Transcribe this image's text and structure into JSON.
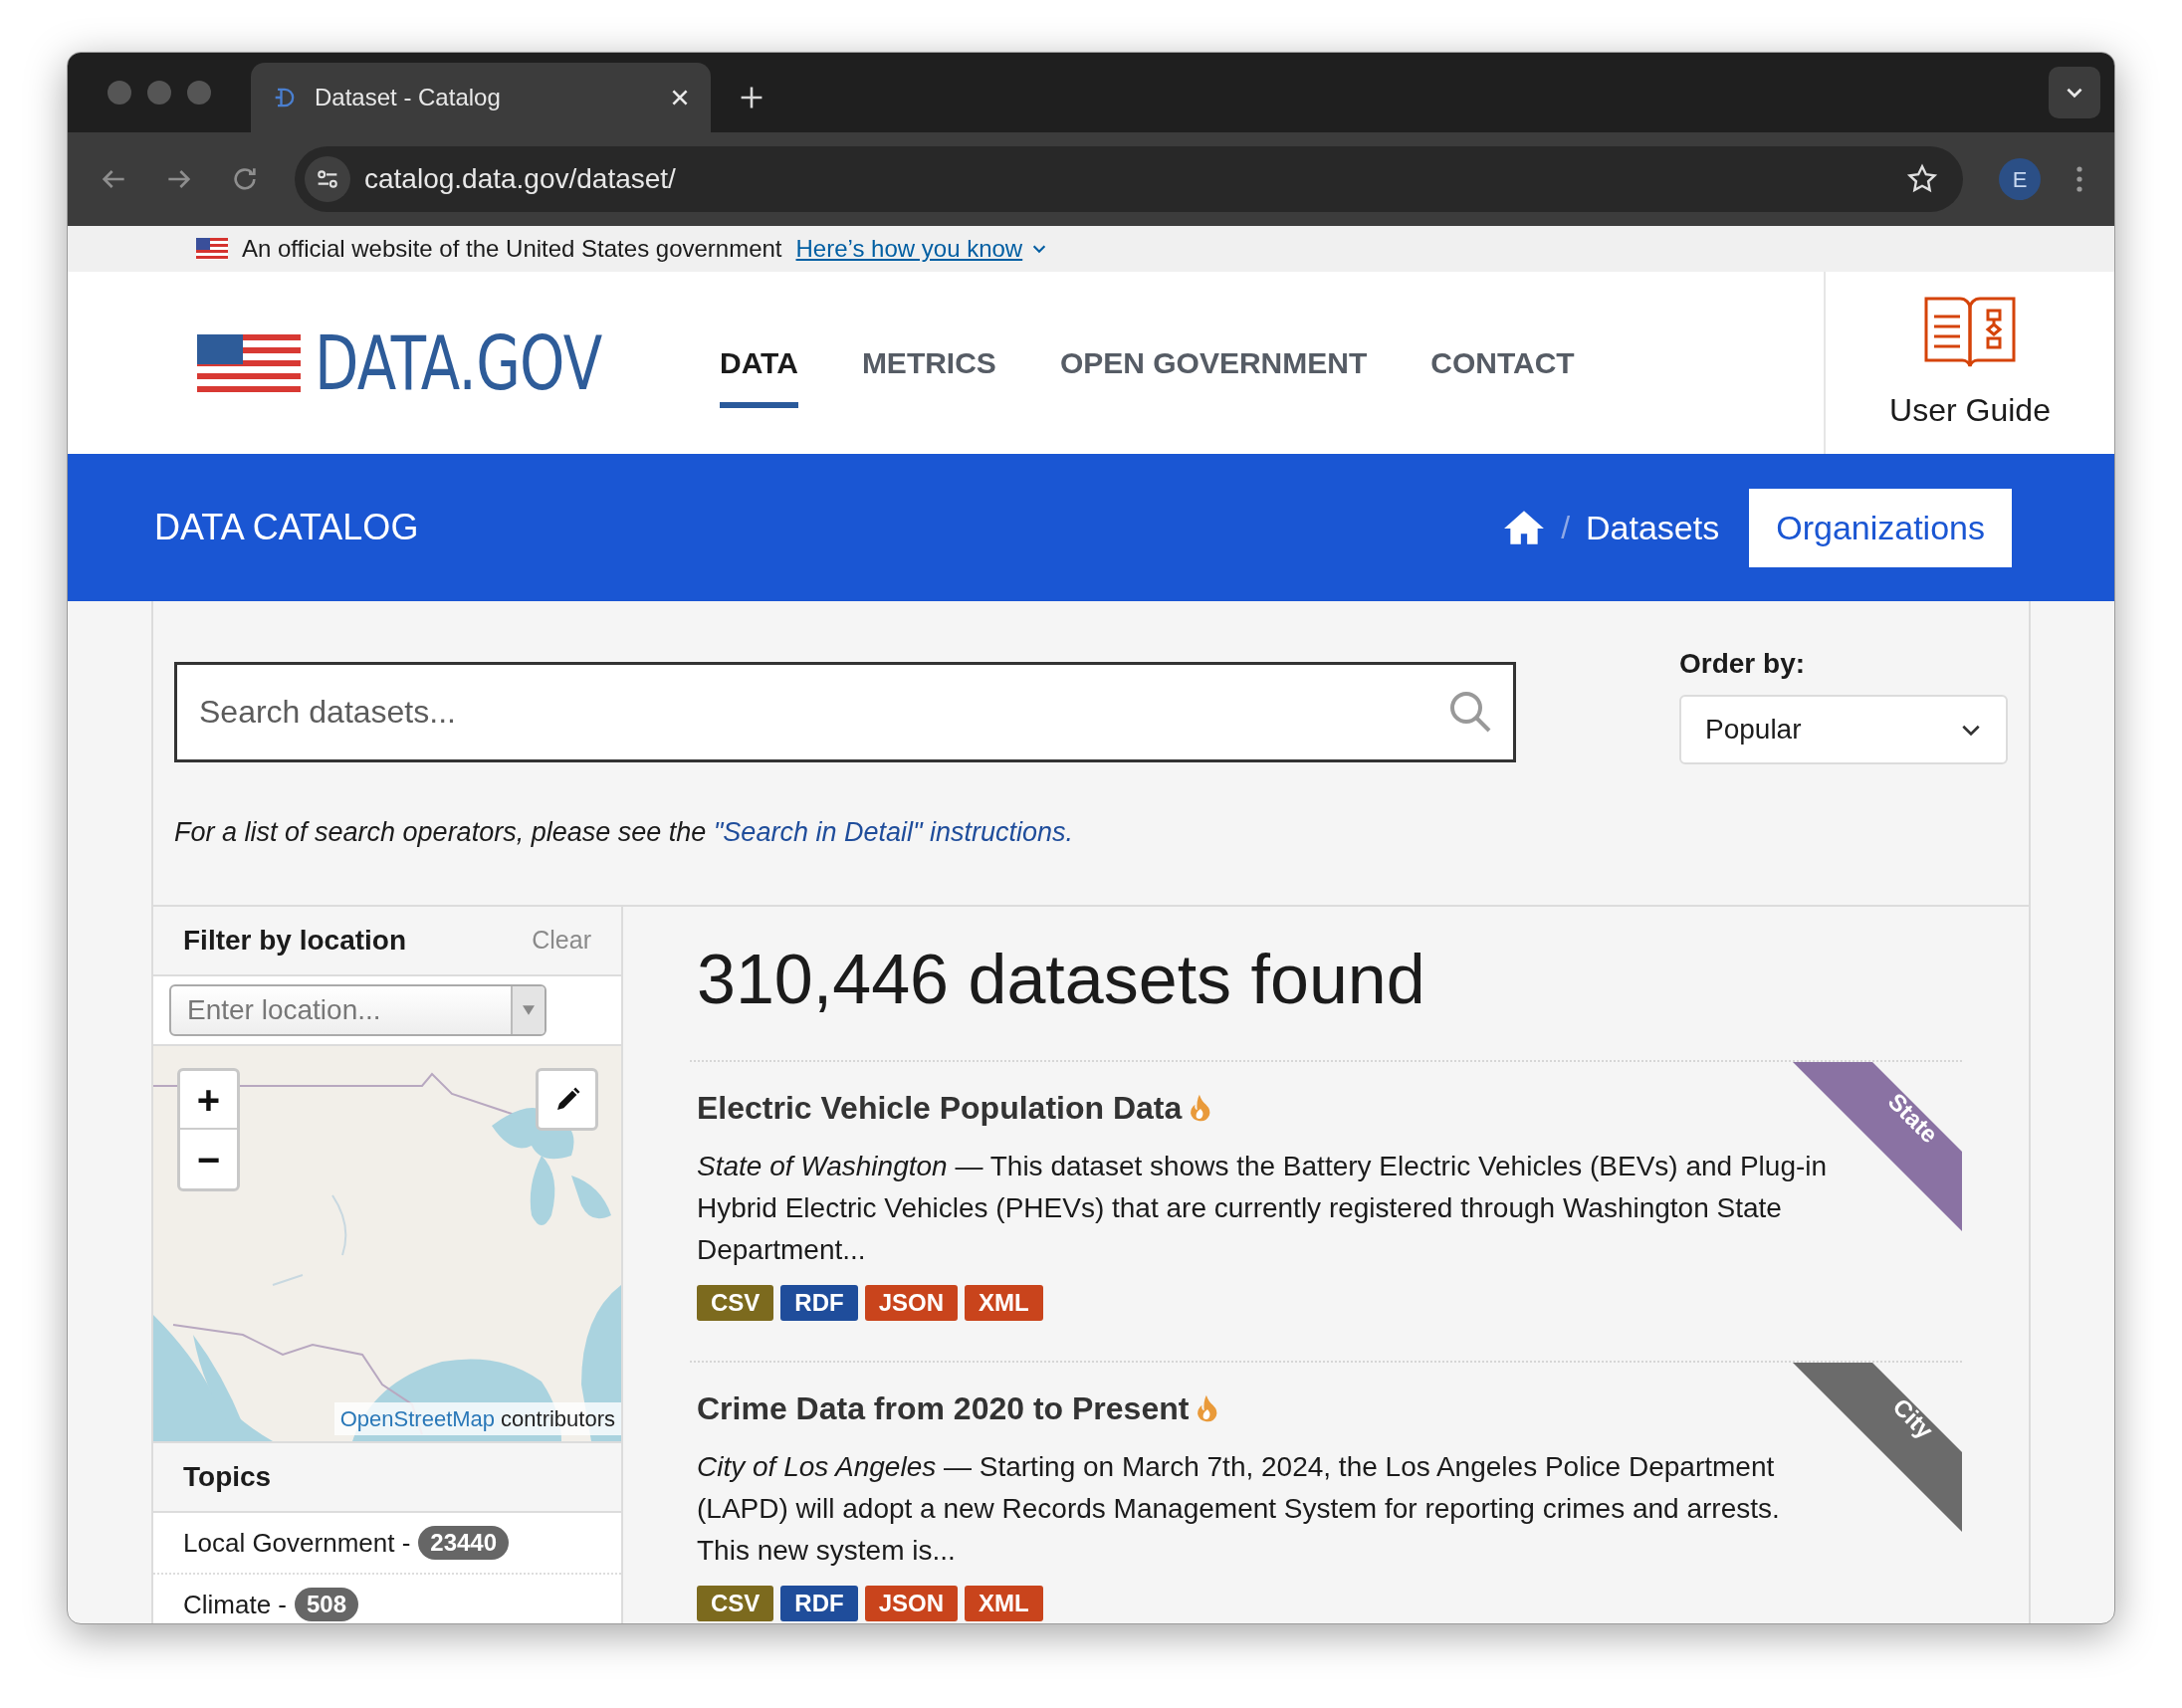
{
  "browser": {
    "tab_title": "Dataset - Catalog",
    "url": "catalog.data.gov/dataset/",
    "profile": "E"
  },
  "gov_banner": {
    "text": "An official website of the United States government",
    "link": "Here’s how you know"
  },
  "header": {
    "logo": "DATA.GOV",
    "user_guide": "User Guide",
    "nav": [
      {
        "label": "DATA",
        "selected": true
      },
      {
        "label": "METRICS",
        "selected": false
      },
      {
        "label": "OPEN GOVERNMENT",
        "selected": false
      },
      {
        "label": "CONTACT",
        "selected": false
      }
    ]
  },
  "catalog_bar": {
    "title": "DATA CATALOG",
    "separator": "/",
    "breadcrumb": "Datasets",
    "button": "Organizations"
  },
  "search": {
    "placeholder": "Search datasets...",
    "order_label": "Order by:",
    "order_value": "Popular",
    "help_text": "For a list of search operators, please see the ",
    "help_link": "\"Search in Detail\" instructions."
  },
  "location_filter": {
    "title": "Filter by location",
    "clear": "Clear",
    "placeholder": "Enter location...",
    "zoom_in": "+",
    "zoom_out": "−",
    "attribution_link": "OpenStreetMap",
    "attribution_text": "contributors"
  },
  "topics": {
    "title": "Topics",
    "items": [
      {
        "label": "Local Government -",
        "count": "23440"
      },
      {
        "label": "Climate -",
        "count": "508"
      }
    ]
  },
  "results": {
    "count_text": "310,446 datasets found",
    "datasets": [
      {
        "title": "Electric Vehicle Population Data",
        "popular": true,
        "publisher": "State of Washington",
        "description": " — This dataset shows the Battery Electric Vehicles (BEVs) and Plug-in Hybrid Electric Vehicles (PHEVs) that are currently registered through Washington State Department...",
        "ribbon": "State",
        "color": "#8a72a3",
        "formats": [
          {
            "label": "CSV",
            "color": "#7c6a1e"
          },
          {
            "label": "RDF",
            "color": "#1f4d9b"
          },
          {
            "label": "JSON",
            "color": "#c9441c"
          },
          {
            "label": "XML",
            "color": "#c9441c"
          }
        ]
      },
      {
        "title": "Crime Data from 2020 to Present",
        "popular": true,
        "publisher": "City of Los Angeles",
        "description": " — Starting on March 7th, 2024, the Los Angeles Police Department (LAPD) will adopt a new Records Management System for reporting crimes and arrests. This new system is...",
        "ribbon": "City",
        "color": "#6b6b6b",
        "formats": [
          {
            "label": "CSV",
            "color": "#7c6a1e"
          },
          {
            "label": "RDF",
            "color": "#1f4d9b"
          },
          {
            "label": "JSON",
            "color": "#c9441c"
          },
          {
            "label": "XML",
            "color": "#c9441c"
          }
        ]
      }
    ]
  }
}
